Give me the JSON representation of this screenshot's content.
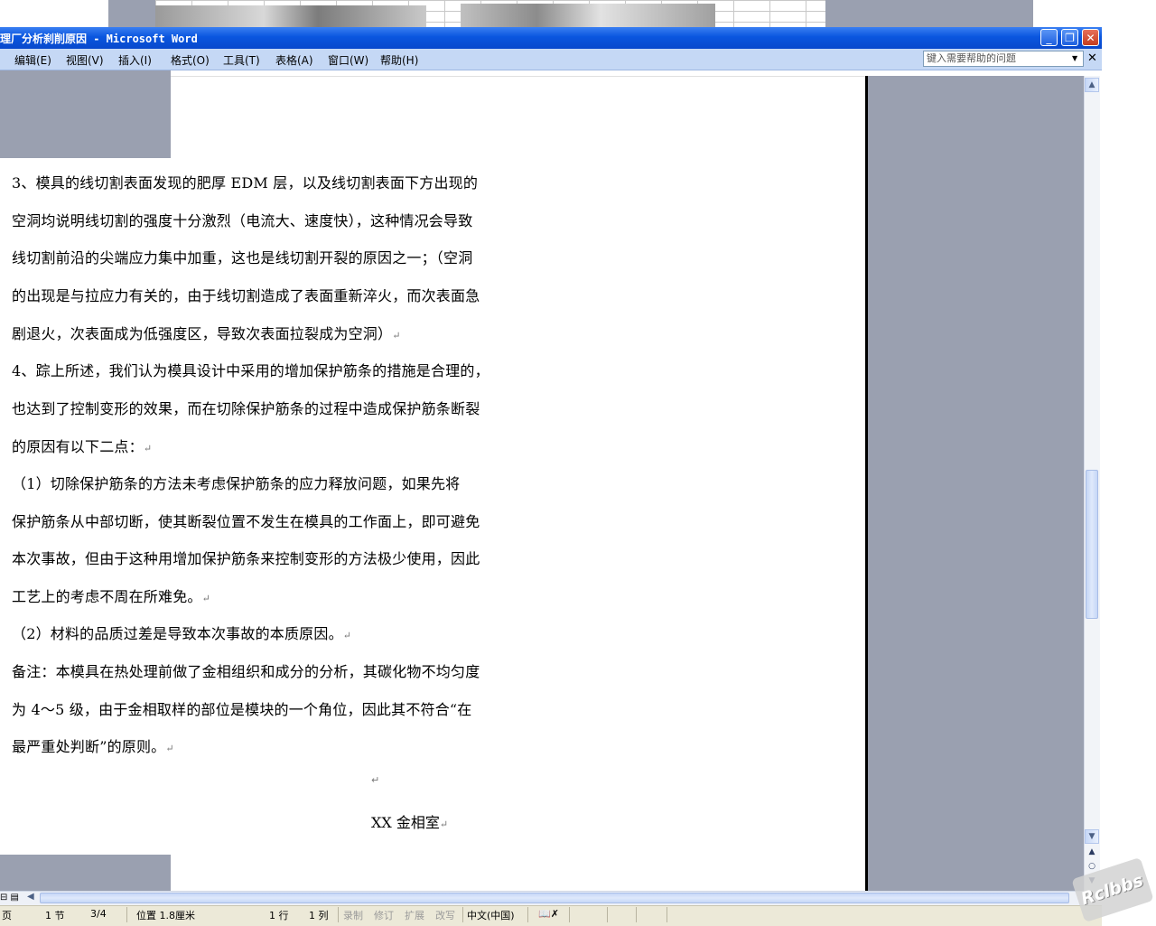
{
  "window": {
    "title": "理厂分析刹削原因 - Microsoft Word",
    "controls": {
      "minimize": "_",
      "restore": "❐",
      "close": "✕"
    }
  },
  "menu": {
    "items": [
      "编辑(E)",
      "视图(V)",
      "插入(I)",
      "格式(O)",
      "工具(T)",
      "表格(A)",
      "窗口(W)",
      "帮助(H)"
    ],
    "help_placeholder": "键入需要帮助的问题"
  },
  "document": {
    "lines": [
      "  3、模具的线切割表面发现的肥厚 EDM 层，以及线切割表面下方出现的",
      "空洞均说明线切割的强度十分激烈（电流大、速度快），这种情况会导致",
      "线切割前沿的尖端应力集中加重，这也是线切割开裂的原因之一；（空洞",
      "的出现是与拉应力有关的，由于线切割造成了表面重新淬火，而次表面急",
      "剧退火，次表面成为低强度区，导致次表面拉裂成为空洞）",
      "  4、踪上所述，我们认为模具设计中采用的增加保护筋条的措施是合理的，",
      "也达到了控制变形的效果，而在切除保护筋条的过程中造成保护筋条断裂",
      "的原因有以下二点：",
      "    （1）切除保护筋条的方法未考虑保护筋条的应力释放问题，如果先将",
      "保护筋条从中部切断，使其断裂位置不发生在模具的工作面上，即可避免",
      "本次事故，但由于这种用增加保护筋条来控制变形的方法极少使用，因此",
      "工艺上的考虑不周在所难免。",
      "  （2）材料的品质过差是导致本次事故的本质原因。",
      " 备注：本模具在热处理前做了金相组织和成分的分析，其碳化物不均匀度",
      " 为 4～5 级，由于金相取样的部位是模块的一个角位，因此其不符合“在",
      " 最严重处判断”的原则。"
    ],
    "paragraph_mark": "↵",
    "signature": "XX 金相室"
  },
  "status": {
    "page": "页",
    "section": "1 节",
    "pages": "3/4",
    "position": "位置 1.8厘米",
    "line": "1 行",
    "column": "1 列",
    "rec": "录制",
    "trk": "修订",
    "ext": "扩展",
    "ovr": "改写",
    "language": "中文(中国)"
  },
  "watermark": "Rclbbs",
  "colors": {
    "title_bar": "#0a56df",
    "menu_bar": "#c5d8f5",
    "workspace_gray": "#9aa0b0",
    "status_bar": "#ece9d8"
  }
}
